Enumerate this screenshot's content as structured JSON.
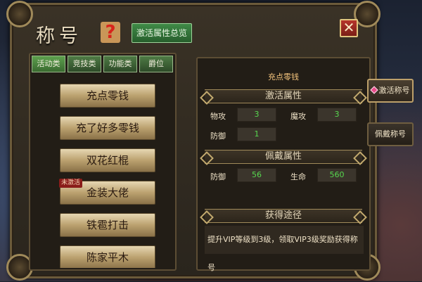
{
  "window": {
    "title": "称号",
    "overview_button": "激活属性总览",
    "close_label": "✕"
  },
  "tabs": [
    {
      "label": "活动类",
      "active": true
    },
    {
      "label": "竞技类"
    },
    {
      "label": "功能类"
    },
    {
      "label": "爵位"
    }
  ],
  "title_list": [
    {
      "label": "充点零钱"
    },
    {
      "label": "充了好多零钱"
    },
    {
      "label": "双花红棍"
    },
    {
      "label": "金装大佬",
      "tag": "未激活"
    },
    {
      "label": "铁雹打击"
    },
    {
      "label": "陈家平木"
    }
  ],
  "detail": {
    "selected_title": "充点零钱",
    "activate_header": "激活属性",
    "activate_stats": [
      {
        "label": "物攻",
        "value": "3"
      },
      {
        "label": "魔攻",
        "value": "3"
      },
      {
        "label": "防御",
        "value": "1"
      }
    ],
    "wear_header": "佩戴属性",
    "wear_stats": [
      {
        "label": "防御",
        "value": "56"
      },
      {
        "label": "生命",
        "value": "560"
      }
    ],
    "obtain_header": "获得途径",
    "obtain_text": "提升VIP等级到3级，领取VIP3级奖励获得称号"
  },
  "side_tabs": [
    {
      "label": "激活称号",
      "active": true
    },
    {
      "label": "佩戴称号"
    }
  ]
}
